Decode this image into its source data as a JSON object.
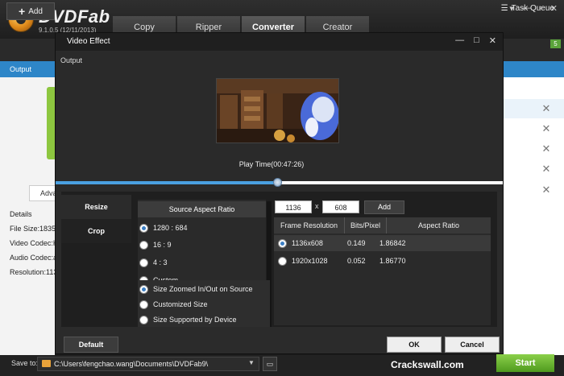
{
  "app": {
    "brand": "DVDFab",
    "version": "9.1.0.5 (12/11/2013)",
    "tabs": [
      {
        "label": "Copy"
      },
      {
        "label": "Ripper"
      },
      {
        "label": "Converter",
        "active": true
      },
      {
        "label": "Creator"
      }
    ],
    "toolbar": {
      "add_label": "Add",
      "task_queue_label": "Task Queue",
      "queue_count": "5"
    },
    "output_label": "Output",
    "advanced_label": "Adva",
    "details": {
      "heading": "Details",
      "file_size": "File Size:1835 M",
      "video_codec": "Video Codec:H.",
      "audio_codec": "Audio Codec:aa",
      "resolution": "Resolution:113"
    },
    "save_to_label": "Save to:",
    "save_path": "C:\\Users\\fengchao.wang\\Documents\\DVDFab9\\",
    "start_label": "Start",
    "watermark": "Crackswall.com"
  },
  "dialog": {
    "title": "Video Effect",
    "output_label": "Output",
    "play_time": "Play Time(00:47:26)",
    "seek_fraction": 0.497,
    "side_tabs": [
      {
        "label": "Resize"
      },
      {
        "label": "Crop"
      }
    ],
    "source_aspect": {
      "header": "Source Aspect Ratio",
      "options": [
        {
          "label": "1280 : 684",
          "selected": true
        },
        {
          "label": "16 : 9",
          "selected": false
        },
        {
          "label": "4 : 3",
          "selected": false
        },
        {
          "label": "Custom",
          "selected": false
        }
      ]
    },
    "size_options": [
      {
        "label": "Size Zoomed In/Out on Source",
        "selected": true
      },
      {
        "label": "Customized Size",
        "selected": false
      },
      {
        "label": "Size Supported by Device",
        "selected": false
      }
    ],
    "width_value": "1136",
    "height_value": "608",
    "x_label": "x",
    "add_label": "Add",
    "table": {
      "headers": [
        "Frame Resolution",
        "Bits/Pixel",
        "Aspect Ratio"
      ],
      "rows": [
        {
          "resolution": "1136x608",
          "bits": "0.149",
          "aspect": "1.86842",
          "selected": true
        },
        {
          "resolution": "1920x1028",
          "bits": "0.052",
          "aspect": "1.86770",
          "selected": false
        }
      ]
    },
    "buttons": {
      "default": "Default",
      "ok": "OK",
      "cancel": "Cancel"
    }
  }
}
